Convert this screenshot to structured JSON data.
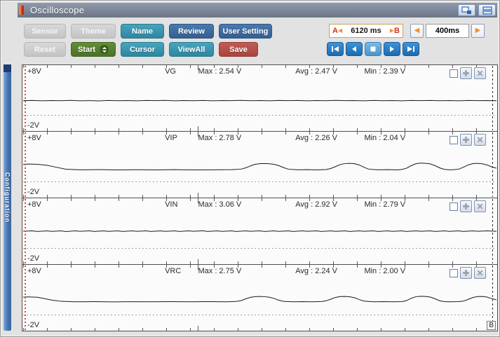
{
  "window": {
    "title": "Oscilloscope"
  },
  "toolbar": {
    "sensor": "Sensor",
    "theme": "Theme",
    "name": "Name",
    "review": "Review",
    "user_setting": "User Setting",
    "reset": "Reset",
    "start": "Start",
    "cursor": "Cursor",
    "viewall": "ViewAll",
    "save": "Save"
  },
  "time_controls": {
    "marker_a": "A",
    "marker_b": "B",
    "range_value": "6120 ms",
    "step_value": "400ms"
  },
  "icons": {
    "arrow_left": "◀",
    "arrow_right": "▶"
  },
  "sidebar": {
    "label": "Configuration"
  },
  "cursor_b_label": "B",
  "colors": {
    "accent_teal": "#3b99b1",
    "accent_steel_blue": "#3a6ba2",
    "accent_green": "#567e2e",
    "accent_red": "#b54b48",
    "playback_blue": "#2f7fc1",
    "cursor_a_red": "#e8463a",
    "arrow_orange": "#f0922f"
  },
  "channels": [
    {
      "name": "VG",
      "top_label": "+8V",
      "bottom_label": "-2V",
      "max": "Max : 2.54 V",
      "avg": "Avg : 2.47 V",
      "min": "Min : 2.39 V",
      "wave": [
        [
          0,
          54
        ],
        [
          2,
          53.7
        ],
        [
          4,
          54.2
        ],
        [
          6,
          53.8
        ],
        [
          8,
          54.1
        ],
        [
          10,
          53.6
        ],
        [
          12,
          54.2
        ],
        [
          14,
          53.9
        ],
        [
          16,
          54.3
        ],
        [
          18,
          53.7
        ],
        [
          20,
          54.1
        ],
        [
          22,
          53.8
        ],
        [
          24,
          54.2
        ],
        [
          26,
          53.7
        ],
        [
          28,
          54
        ],
        [
          30,
          53.6
        ],
        [
          32,
          54.2
        ],
        [
          34,
          53.8
        ],
        [
          36,
          54.1
        ],
        [
          38,
          53.7
        ],
        [
          40,
          54.2
        ],
        [
          42,
          53.8
        ],
        [
          44,
          54
        ],
        [
          46,
          53.6
        ],
        [
          48,
          54.1
        ],
        [
          50,
          53.8
        ],
        [
          52,
          54.2
        ],
        [
          54,
          53.7
        ],
        [
          56,
          54
        ],
        [
          58,
          53.7
        ],
        [
          60,
          54.2
        ],
        [
          62,
          53.8
        ],
        [
          64,
          54.1
        ],
        [
          66,
          53.6
        ],
        [
          68,
          54
        ],
        [
          70,
          53.8
        ],
        [
          72,
          54.2
        ],
        [
          74,
          53.7
        ],
        [
          76,
          54.1
        ],
        [
          78,
          53.8
        ],
        [
          80,
          54.2
        ],
        [
          82,
          53.7
        ],
        [
          84,
          54
        ],
        [
          86,
          53.7
        ],
        [
          88,
          54.1
        ],
        [
          90,
          53.8
        ],
        [
          92,
          54.2
        ],
        [
          94,
          53.7
        ],
        [
          96,
          54
        ],
        [
          98,
          53.8
        ],
        [
          100,
          54.1
        ]
      ]
    },
    {
      "name": "VIP",
      "top_label": "+8V",
      "bottom_label": "-2V",
      "max": "Max : 2.78 V",
      "avg": "Avg : 2.26 V",
      "min": "Min : 2.04 V",
      "wave": [
        [
          0,
          49.5
        ],
        [
          1,
          49
        ],
        [
          3,
          49.5
        ],
        [
          5,
          51
        ],
        [
          7,
          54
        ],
        [
          9,
          57
        ],
        [
          12,
          58
        ],
        [
          16,
          57.8
        ],
        [
          20,
          58.2
        ],
        [
          24,
          57.9
        ],
        [
          28,
          58.1
        ],
        [
          32,
          57.8
        ],
        [
          36,
          58.2
        ],
        [
          40,
          58
        ],
        [
          44,
          57.8
        ],
        [
          46,
          57
        ],
        [
          47,
          55
        ],
        [
          48,
          52
        ],
        [
          49,
          49.5
        ],
        [
          50,
          48.5
        ],
        [
          51,
          48.2
        ],
        [
          52,
          48.6
        ],
        [
          53,
          49.5
        ],
        [
          54,
          51.5
        ],
        [
          55,
          54.5
        ],
        [
          56,
          57
        ],
        [
          58,
          58
        ],
        [
          60,
          57.8
        ],
        [
          62,
          58.1
        ],
        [
          64,
          57.6
        ],
        [
          65,
          56
        ],
        [
          66,
          53
        ],
        [
          67,
          49.8
        ],
        [
          68,
          48.3
        ],
        [
          69,
          48
        ],
        [
          70,
          48.5
        ],
        [
          71,
          50.5
        ],
        [
          72,
          54
        ],
        [
          73,
          57
        ],
        [
          75,
          58
        ],
        [
          77,
          57.8
        ],
        [
          79,
          58.1
        ],
        [
          80,
          57.5
        ],
        [
          81,
          55.5
        ],
        [
          82,
          51.5
        ],
        [
          83,
          48.5
        ],
        [
          84,
          47.6
        ],
        [
          85,
          47.9
        ],
        [
          86,
          48.8
        ],
        [
          87,
          51.5
        ],
        [
          88,
          55
        ],
        [
          89,
          57.3
        ],
        [
          90,
          58
        ],
        [
          91,
          57.8
        ],
        [
          92,
          57
        ],
        [
          93,
          54
        ],
        [
          94,
          50.5
        ],
        [
          95,
          48.4
        ],
        [
          96,
          48
        ],
        [
          97,
          48.6
        ],
        [
          98,
          50.5
        ],
        [
          99,
          53.5
        ],
        [
          100,
          55.5
        ]
      ]
    },
    {
      "name": "VIN",
      "top_label": "+8V",
      "bottom_label": "-2V",
      "max": "Max : 3.06 V",
      "avg": "Avg : 2.92 V",
      "min": "Min : 2.79 V",
      "wave": [
        [
          0,
          50
        ],
        [
          2,
          49.4
        ],
        [
          3,
          50.4
        ],
        [
          5,
          49.5
        ],
        [
          6,
          50.3
        ],
        [
          8,
          49.4
        ],
        [
          9,
          50.5
        ],
        [
          11,
          49.5
        ],
        [
          12,
          50.2
        ],
        [
          14,
          49.4
        ],
        [
          15,
          50.4
        ],
        [
          17,
          49.5
        ],
        [
          18,
          50.3
        ],
        [
          20,
          49.4
        ],
        [
          21,
          50.4
        ],
        [
          23,
          49.5
        ],
        [
          24,
          50.2
        ],
        [
          26,
          49.4
        ],
        [
          27,
          50.4
        ],
        [
          29,
          49.5
        ],
        [
          30,
          50.3
        ],
        [
          32,
          49.4
        ],
        [
          33,
          50.4
        ],
        [
          35,
          49.5
        ],
        [
          36,
          50.2
        ],
        [
          38,
          49.3
        ],
        [
          39,
          50.4
        ],
        [
          41,
          49.5
        ],
        [
          42,
          50.3
        ],
        [
          44,
          49.4
        ],
        [
          45,
          50.4
        ],
        [
          47,
          49.5
        ],
        [
          48,
          50.2
        ],
        [
          50,
          49.4
        ],
        [
          51,
          50.4
        ],
        [
          53,
          49.5
        ],
        [
          54,
          50.3
        ],
        [
          56,
          49.4
        ],
        [
          57,
          50.4
        ],
        [
          59,
          49.5
        ],
        [
          60,
          50.2
        ],
        [
          62,
          49.4
        ],
        [
          63,
          50.4
        ],
        [
          65,
          49.5
        ],
        [
          66,
          50.3
        ],
        [
          68,
          49.4
        ],
        [
          69,
          50.4
        ],
        [
          71,
          49.5
        ],
        [
          72,
          50.2
        ],
        [
          74,
          49.4
        ],
        [
          75,
          50.4
        ],
        [
          77,
          49.5
        ],
        [
          78,
          50.3
        ],
        [
          80,
          49.4
        ],
        [
          81,
          50.4
        ],
        [
          83,
          49.5
        ],
        [
          84,
          50.2
        ],
        [
          86,
          49.4
        ],
        [
          87,
          50.4
        ],
        [
          89,
          49.5
        ],
        [
          90,
          50.3
        ],
        [
          92,
          49.4
        ],
        [
          93,
          50.4
        ],
        [
          95,
          49.5
        ],
        [
          96,
          50.2
        ],
        [
          98,
          49.4
        ],
        [
          100,
          50.2
        ]
      ]
    },
    {
      "name": "VRC",
      "top_label": "+8V",
      "bottom_label": "-2V",
      "max": "Max : 2.75 V",
      "avg": "Avg : 2.24 V",
      "min": "Min : 2.00 V",
      "wave": [
        [
          0,
          49
        ],
        [
          1,
          48.7
        ],
        [
          3,
          49.2
        ],
        [
          4,
          50.5
        ],
        [
          6,
          53.5
        ],
        [
          8,
          55.5
        ],
        [
          11,
          56.2
        ],
        [
          15,
          56
        ],
        [
          19,
          56.4
        ],
        [
          23,
          56.1
        ],
        [
          27,
          56.3
        ],
        [
          31,
          56
        ],
        [
          35,
          56.3
        ],
        [
          39,
          56
        ],
        [
          43,
          56.2
        ],
        [
          45,
          55.7
        ],
        [
          46,
          54.5
        ],
        [
          47,
          51.8
        ],
        [
          48,
          49.3
        ],
        [
          49,
          48.2
        ],
        [
          50,
          47.9
        ],
        [
          51,
          48.3
        ],
        [
          52,
          49.2
        ],
        [
          53,
          51
        ],
        [
          54,
          53.8
        ],
        [
          55,
          55.6
        ],
        [
          57,
          56.2
        ],
        [
          59,
          56
        ],
        [
          61,
          56.3
        ],
        [
          63,
          55.9
        ],
        [
          64,
          54.8
        ],
        [
          65,
          52.2
        ],
        [
          66,
          49.4
        ],
        [
          67,
          48.1
        ],
        [
          68,
          47.9
        ],
        [
          69,
          48.5
        ],
        [
          70,
          49.9
        ],
        [
          71,
          52.8
        ],
        [
          72,
          55.2
        ],
        [
          74,
          56.2
        ],
        [
          76,
          56
        ],
        [
          78,
          56.3
        ],
        [
          80,
          56
        ],
        [
          81,
          54.4
        ],
        [
          82,
          50.8
        ],
        [
          83,
          48.3
        ],
        [
          84,
          47.7
        ],
        [
          85,
          48
        ],
        [
          86,
          48.9
        ],
        [
          87,
          51.5
        ],
        [
          88,
          54.6
        ],
        [
          89,
          56
        ],
        [
          90,
          56.2
        ],
        [
          92,
          56
        ],
        [
          93,
          55.2
        ],
        [
          94,
          52.6
        ],
        [
          95,
          49.6
        ],
        [
          96,
          48.1
        ],
        [
          97,
          47.9
        ],
        [
          98,
          48.9
        ],
        [
          99,
          51.3
        ],
        [
          100,
          53.2
        ]
      ]
    }
  ]
}
